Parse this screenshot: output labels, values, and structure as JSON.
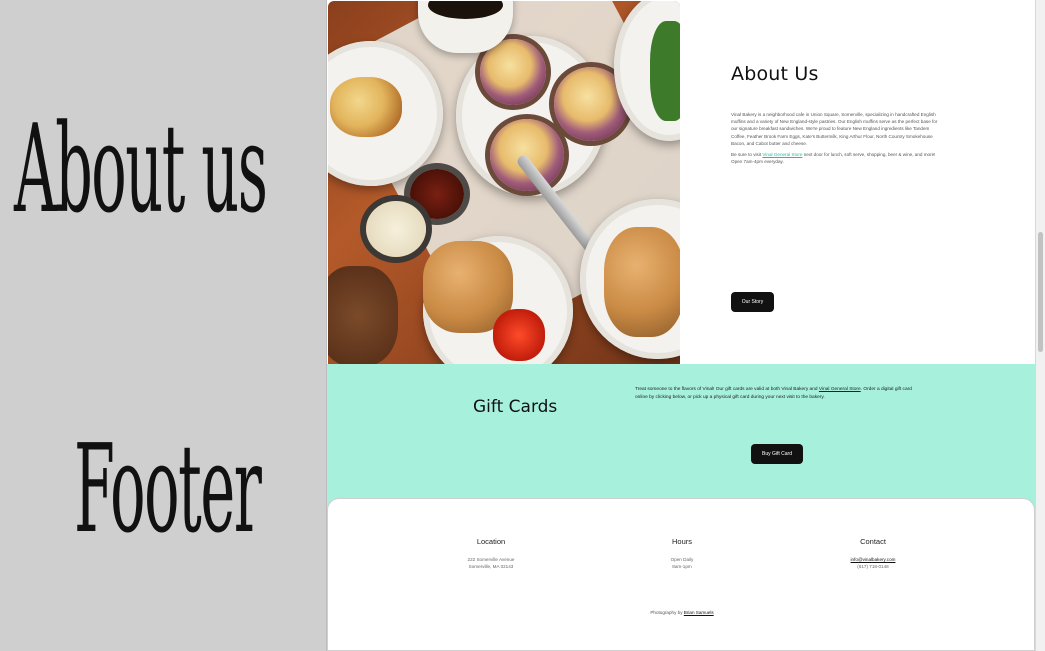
{
  "left_labels": {
    "about": "About us",
    "footer": "Footer"
  },
  "about": {
    "title": "About Us",
    "p1": "Vinal Bakery is a neighborhood cafe in Union Square, Somerville, specializing in handcrafted English muffins and a variety of New England-style pastries. Our English muffins serve as the perfect base for our signature breakfast sandwiches. We're proud to feature New England ingredients like Tandem Coffee, Feather Brook Farm Eggs, Kate's Buttermilk, King Arthur Flour, North Country Smokehouse Bacon, and Cabot butter and cheese.",
    "p2_before": "Be sure to visit ",
    "p2_link": "Vinal General Store",
    "p2_after": " next door for lunch, soft serve, shopping, beer & wine, and more! Open 7am-4pm everyday.",
    "button": "Our Story"
  },
  "gift": {
    "title": "Gift Cards",
    "body_before": "Treat someone to the flavors of Vinal! Our gift cards are valid at both Vinal Bakery and ",
    "body_link": "Vinal General Store",
    "body_after": ". Order a digital gift card online by clicking below, or pick up a physical gift card during your next visit to the bakery.",
    "button": "Buy Gift Card"
  },
  "footer": {
    "location": {
      "title": "Location",
      "line1": "222 Somerville Avenue",
      "line2": "Somerville, MA 02143"
    },
    "hours": {
      "title": "Hours",
      "line1": "Open Daily",
      "line2": "8am-1pm"
    },
    "contact": {
      "title": "Contact",
      "email": "info@vinalbakery.com",
      "phone": "(617) 718-0148"
    },
    "credit_before": "Photography by ",
    "credit_name": "Brian Samuels"
  },
  "photo": {
    "icon": "bakery-food-photo"
  }
}
